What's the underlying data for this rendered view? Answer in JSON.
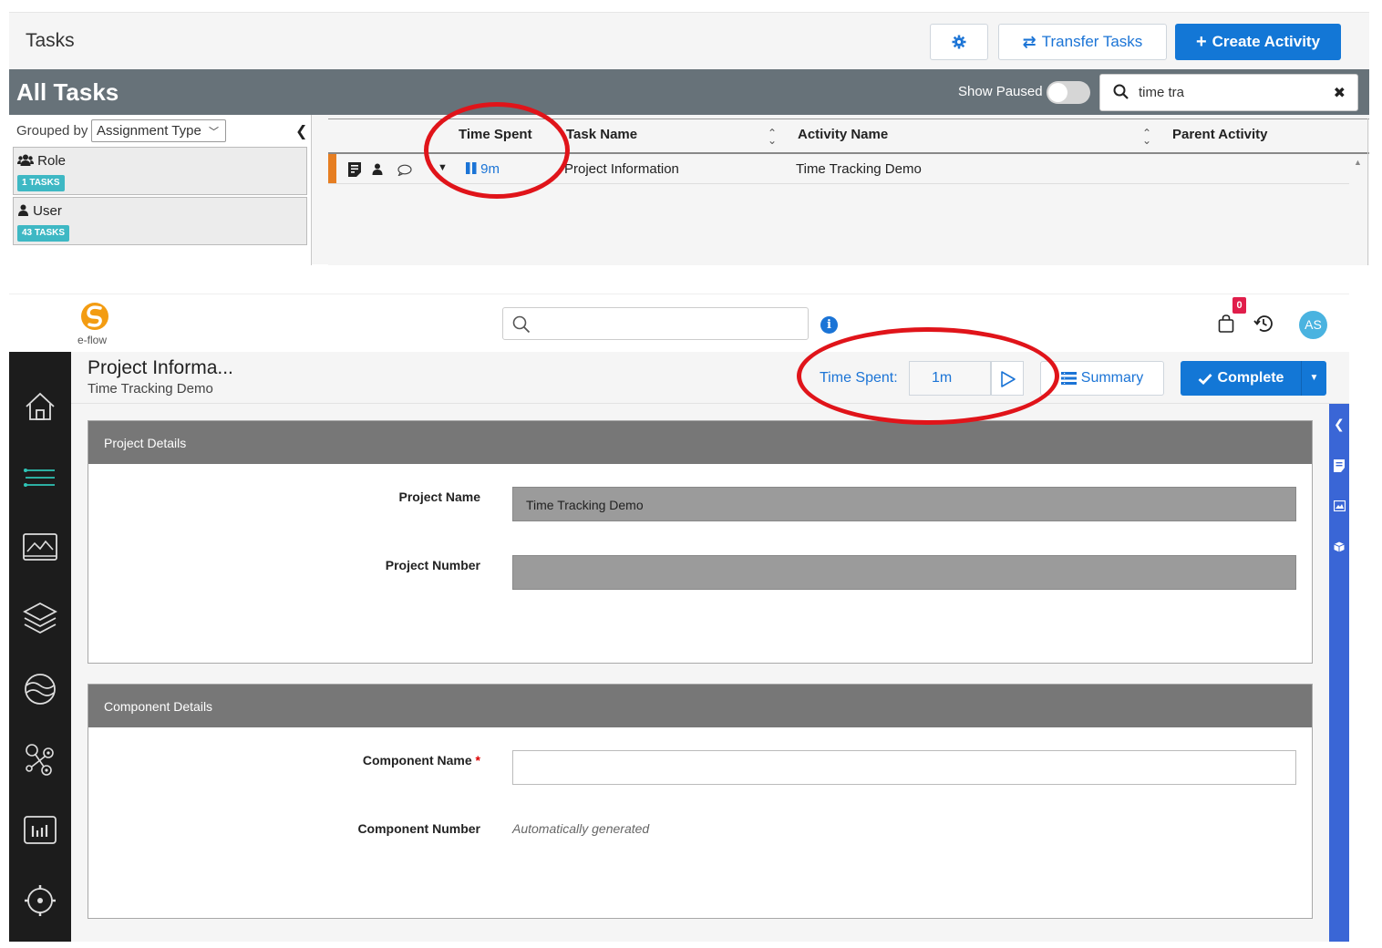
{
  "tasks_panel": {
    "title": "Tasks",
    "transfer_label": "Transfer Tasks",
    "create_label": "Create Activity",
    "list_title": "All Tasks",
    "show_paused_label": "Show Paused",
    "search_value": "time tra",
    "grouped_by_label": "Grouped by",
    "grouped_by_value": "Assignment Type",
    "groups": [
      {
        "label": "Role",
        "count": "1 TASKS",
        "icon": "users-icon"
      },
      {
        "label": "User",
        "count": "43 TASKS",
        "icon": "user-icon"
      }
    ],
    "columns": [
      "Time Spent",
      "Task Name",
      "Activity Name",
      "Parent Activity"
    ],
    "rows": [
      {
        "time_spent": "9m",
        "task_name": "Project Information",
        "activity_name": "Time Tracking Demo",
        "parent_activity": ""
      }
    ]
  },
  "app": {
    "logo_text": "e-flow",
    "cart_count": "0",
    "avatar_initials": "AS",
    "page_title": "Project Informa...",
    "page_subtitle": "Time Tracking Demo",
    "time_spent_label": "Time Spent:",
    "time_spent_value": "1m",
    "summary_label": "Summary",
    "complete_label": "Complete",
    "sections": [
      {
        "title": "Project Details",
        "fields": [
          {
            "label": "Project Name",
            "value": "Time Tracking Demo"
          },
          {
            "label": "Project Number",
            "value": ""
          }
        ]
      },
      {
        "title": "Component Details",
        "fields": [
          {
            "label": "Component Name",
            "required_mark": "*",
            "value": ""
          },
          {
            "label": "Component Number",
            "hint": "Automatically generated"
          }
        ]
      }
    ],
    "nav_icons": [
      "home-icon",
      "list-icon",
      "image-icon",
      "layers-icon",
      "globe-icon",
      "network-icon",
      "chart-icon",
      "settings-icon"
    ]
  },
  "colors": {
    "accent_blue": "#1377d6",
    "header_gray": "#677279",
    "badge_teal": "#3eb8c4",
    "task_stripe": "#e67e22",
    "annotation_red": "#e0141a",
    "rail_blue": "#3a66d6"
  }
}
